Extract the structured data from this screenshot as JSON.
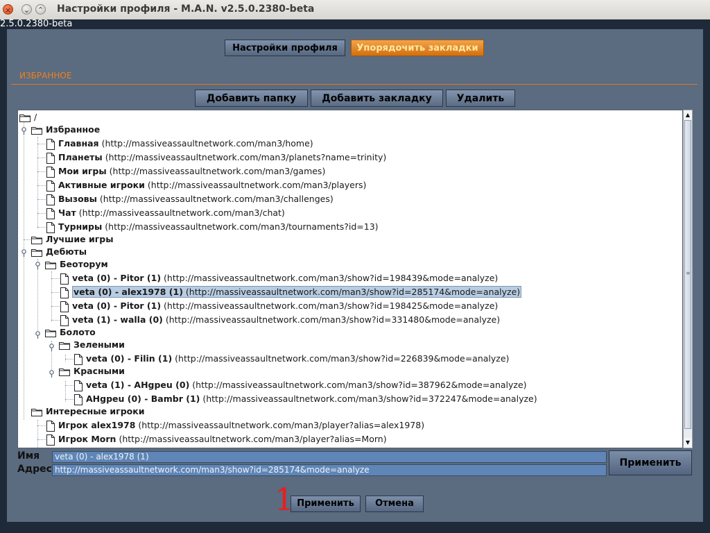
{
  "window": {
    "title": "Настройки профиля - M.A.N. v2.5.0.2380-beta",
    "version_text": "2.5.0.2380-beta",
    "controls": {
      "close": "×",
      "minimize": "⌄",
      "maximize": "⌃"
    }
  },
  "top_tabs": {
    "profile": "Настройки профиля",
    "bookmarks": "Упорядочить закладки"
  },
  "section": {
    "title": "ИЗБРАННОЕ"
  },
  "toolbar": {
    "add_folder": "Добавить папку",
    "add_bookmark": "Добавить закладку",
    "delete": "Удалить"
  },
  "tree": {
    "root": "/",
    "favorites": {
      "label": "Избранное",
      "items": [
        {
          "name": "Главная",
          "url": "(http://massiveassaultnetwork.com/man3/home)"
        },
        {
          "name": "Планеты",
          "url": "(http://massiveassaultnetwork.com/man3/planets?name=trinity)"
        },
        {
          "name": "Мои игры",
          "url": "(http://massiveassaultnetwork.com/man3/games)"
        },
        {
          "name": "Активные игроки",
          "url": "(http://massiveassaultnetwork.com/man3/players)"
        },
        {
          "name": "Вызовы",
          "url": "(http://massiveassaultnetwork.com/man3/challenges)"
        },
        {
          "name": "Чат",
          "url": "(http://massiveassaultnetwork.com/man3/chat)"
        },
        {
          "name": "Турниры",
          "url": "(http://massiveassaultnetwork.com/man3/tournaments?id=13)"
        }
      ]
    },
    "best_games": {
      "label": "Лучшие игры"
    },
    "debuts": {
      "label": "Дебюты",
      "beotorum": {
        "label": "Беоторум",
        "items": [
          {
            "name": "veta (0) - Pitor (1)",
            "url": "(http://massiveassaultnetwork.com/man3/show?id=198439&mode=analyze)"
          },
          {
            "name": "veta (0) - alex1978 (1)",
            "url": "(http://massiveassaultnetwork.com/man3/show?id=285174&mode=analyze)"
          },
          {
            "name": "veta (0) - Pitor (1)",
            "url": "(http://massiveassaultnetwork.com/man3/show?id=198425&mode=analyze)"
          },
          {
            "name": "veta (1) - walla (0)",
            "url": "(http://massiveassaultnetwork.com/man3/show?id=331480&mode=analyze)"
          }
        ]
      },
      "boloto": {
        "label": "Болото",
        "green": {
          "label": "Зелеными",
          "items": [
            {
              "name": "veta (0) - Filin (1)",
              "url": "(http://massiveassaultnetwork.com/man3/show?id=226839&mode=analyze)"
            }
          ]
        },
        "red": {
          "label": "Красными",
          "items": [
            {
              "name": "veta (1) - AHgpeu (0)",
              "url": "(http://massiveassaultnetwork.com/man3/show?id=387962&mode=analyze)"
            },
            {
              "name": "AHgpeu (0) - Bambr (1)",
              "url": "(http://massiveassaultnetwork.com/man3/show?id=372247&mode=analyze)"
            }
          ]
        }
      }
    },
    "interesting": {
      "label": "Интересные игроки",
      "items": [
        {
          "name": "Игрок alex1978",
          "url": "(http://massiveassaultnetwork.com/man3/player?alias=alex1978)"
        },
        {
          "name": "Игрок Morn",
          "url": "(http://massiveassaultnetwork.com/man3/player?alias=Morn)"
        }
      ]
    }
  },
  "form": {
    "name_label": "Имя",
    "name_value": "veta (0) - alex1978 (1)",
    "address_label": "Адрес",
    "address_value": "http://massiveassaultnetwork.com/man3/show?id=285174&mode=analyze",
    "apply_side": "Применить"
  },
  "bottom": {
    "marker": "1",
    "apply": "Применить",
    "cancel": "Отмена"
  }
}
